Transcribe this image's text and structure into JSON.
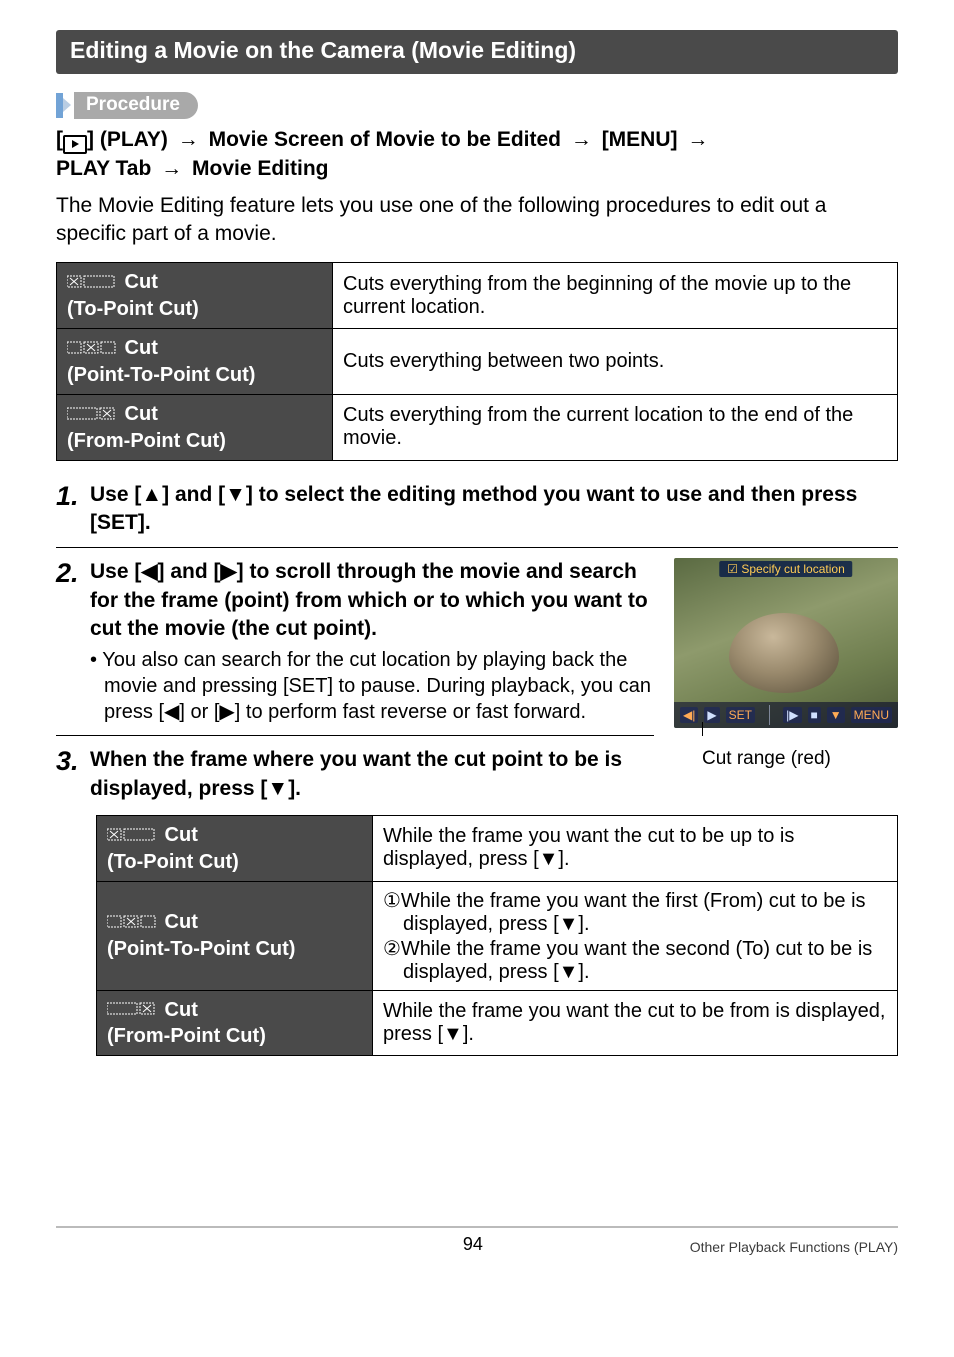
{
  "section_title": "Editing a Movie on the Camera (Movie Editing)",
  "procedure_label": "Procedure",
  "path": {
    "seg1_prefix": "[",
    "seg1_suffix": "] (PLAY)",
    "seg2": "Movie Screen of Movie to be Edited",
    "seg3": "[MENU]",
    "seg4": "PLAY Tab",
    "seg5": "Movie Editing",
    "arrow": "→"
  },
  "intro": "The Movie Editing feature lets you use one of the following procedures to edit out a specific part of a movie.",
  "cut_table": [
    {
      "label_line1": " Cut",
      "label_line2": "(To-Point Cut)",
      "desc": "Cuts everything from the beginning of the movie up to the current location."
    },
    {
      "label_line1": " Cut",
      "label_line2": "(Point-To-Point Cut)",
      "desc": "Cuts everything between two points."
    },
    {
      "label_line1": " Cut",
      "label_line2": "(From-Point Cut)",
      "desc": "Cuts everything from the current location to the end of the movie."
    }
  ],
  "steps": {
    "s1": {
      "num": "1.",
      "title": "Use [▲] and [▼] to select the editing method you want to use and then press [SET]."
    },
    "s2": {
      "num": "2.",
      "title": "Use [◀] and [▶] to scroll through the movie and search for the frame (point) from which or to which you want to cut the movie (the cut point).",
      "note": "• You also can search for the cut location by playing back the movie and pressing [SET] to pause. During playback, you can press [◀] or [▶] to perform fast reverse or fast forward."
    },
    "s3": {
      "num": "3.",
      "title": "When the frame where you want the cut point to be is displayed, press [▼]."
    }
  },
  "screenshot": {
    "top_label": "☑ Specify cut location",
    "bb_left1": "◀|",
    "bb_left2": "▶",
    "bb_set": "SET",
    "bb_r1": "|▶",
    "bb_r2": "■",
    "bb_r3": "▼",
    "bb_menu": "MENU"
  },
  "caption": "Cut range (red)",
  "inner_table": [
    {
      "label_line1": " Cut",
      "label_line2": "(To-Point Cut)",
      "desc": "While the frame you want the cut to be up to is displayed, press [▼]."
    },
    {
      "label_line1": " Cut",
      "label_line2": "(Point-To-Point Cut)",
      "desc_lines": [
        "①While the frame you want the first (From) cut to be is displayed, press [▼].",
        "②While the frame you want the second (To) cut to be is displayed, press [▼]."
      ]
    },
    {
      "label_line1": " Cut",
      "label_line2": "(From-Point Cut)",
      "desc": "While the frame you want the cut to be from is displayed, press [▼]."
    }
  ],
  "footer": {
    "page": "94",
    "right": "Other Playback Functions (PLAY)"
  }
}
